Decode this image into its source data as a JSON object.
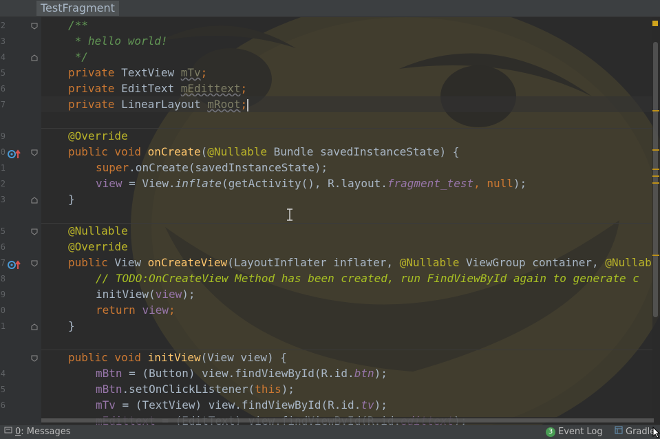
{
  "editor_tab": {
    "title": "TestFragment"
  },
  "gutter": {
    "line_numbers": [
      "2",
      "3",
      "4",
      "5",
      "6",
      "7",
      "",
      "9",
      "0",
      "1",
      "2",
      "3",
      "",
      "5",
      "6",
      "7",
      "8",
      "9",
      "0",
      "1",
      "",
      "3",
      "4",
      "5",
      "6"
    ]
  },
  "code": {
    "l1": "/**",
    "l2": " * hello world!",
    "l3": " */",
    "l4": {
      "kw": "private",
      "type": " TextView ",
      "name": "mTv",
      "semi": ";"
    },
    "l5": {
      "kw": "private",
      "type": " EditText ",
      "name": "mEdittext",
      "semi": ";"
    },
    "l6": {
      "kw": "private",
      "type": " LinearLayout ",
      "name": "mRoot",
      "semi": ";"
    },
    "l7": "@Override",
    "l8": {
      "kw1": "public",
      "kw2": " void ",
      "meth": "onCreate",
      "open": "(",
      "ann": "@Nullable",
      "rest": " Bundle savedInstanceState) {"
    },
    "l9": {
      "kw": "super",
      "rest": ".onCreate(savedInstanceState);"
    },
    "l10": {
      "fld": "view",
      "mid": " = View.",
      "itl": "inflate",
      "args": "(getActivity(), R.layout.",
      "ifld": "fragment_test",
      "comma": ", ",
      "kw": "null",
      "end": ");"
    },
    "l11": "}",
    "l12": "@Nullable",
    "l13": "@Override",
    "l14": {
      "kw": "public",
      "type": " View ",
      "meth": "onCreateView",
      "a": "(LayoutInflater inflater, ",
      "ann1": "@Nullable",
      "b": " ViewGroup container, ",
      "ann2": "@Nullable"
    },
    "l15": {
      "slashes": "// ",
      "todo": "TODO:OnCreateView Method has been created, run FindViewById again to generate c"
    },
    "l16": {
      "call": "initView(",
      "fld": "view",
      "end": ");"
    },
    "l17": {
      "kw": "return",
      "sp": " ",
      "fld": "view",
      "end": ";"
    },
    "l18": "}",
    "l19": {
      "kw1": "public",
      "kw2": " void ",
      "meth": "initView",
      "rest": "(View view) {"
    },
    "l20": {
      "fld": "mBtn",
      "a": " = (Button) view.findViewById(R.id.",
      "ifld": "btn",
      "end": ");"
    },
    "l21": {
      "fld": "mBtn",
      "a": ".setOnClickListener(",
      "kw": "this",
      "end": ");"
    },
    "l22": {
      "fld": "mTv",
      "a": " = (TextView) view.findViewById(R.id.",
      "ifld": "tv",
      "end": ");"
    },
    "l23": {
      "fld": "mEdittext",
      "a": " = (EditText) view.findViewById(R.id.",
      "ifld": "edittext",
      "end": ");"
    }
  },
  "statusbar": {
    "messages_mnemonic": "0",
    "messages_label": ": Messages",
    "event_log_badge": "3",
    "event_log_label": "Event Log",
    "gradle_label": "Gradle"
  },
  "colors": {
    "editor_background": "#2b2b2b",
    "keyword": "#cc7832",
    "annotation": "#bbb529",
    "method_declaration": "#ffc66d",
    "doc_comment": "#629755",
    "todo": "#a8c023",
    "field": "#9876aa",
    "plain_text": "#a9b7c6",
    "event_log_badge": "#499c54"
  },
  "icons": {
    "override_marker": "override-arrow-icon",
    "fold": "fold-marker-icon",
    "event_log": "event-log-icon",
    "gradle": "gradle-icon",
    "messages": "messages-icon"
  }
}
